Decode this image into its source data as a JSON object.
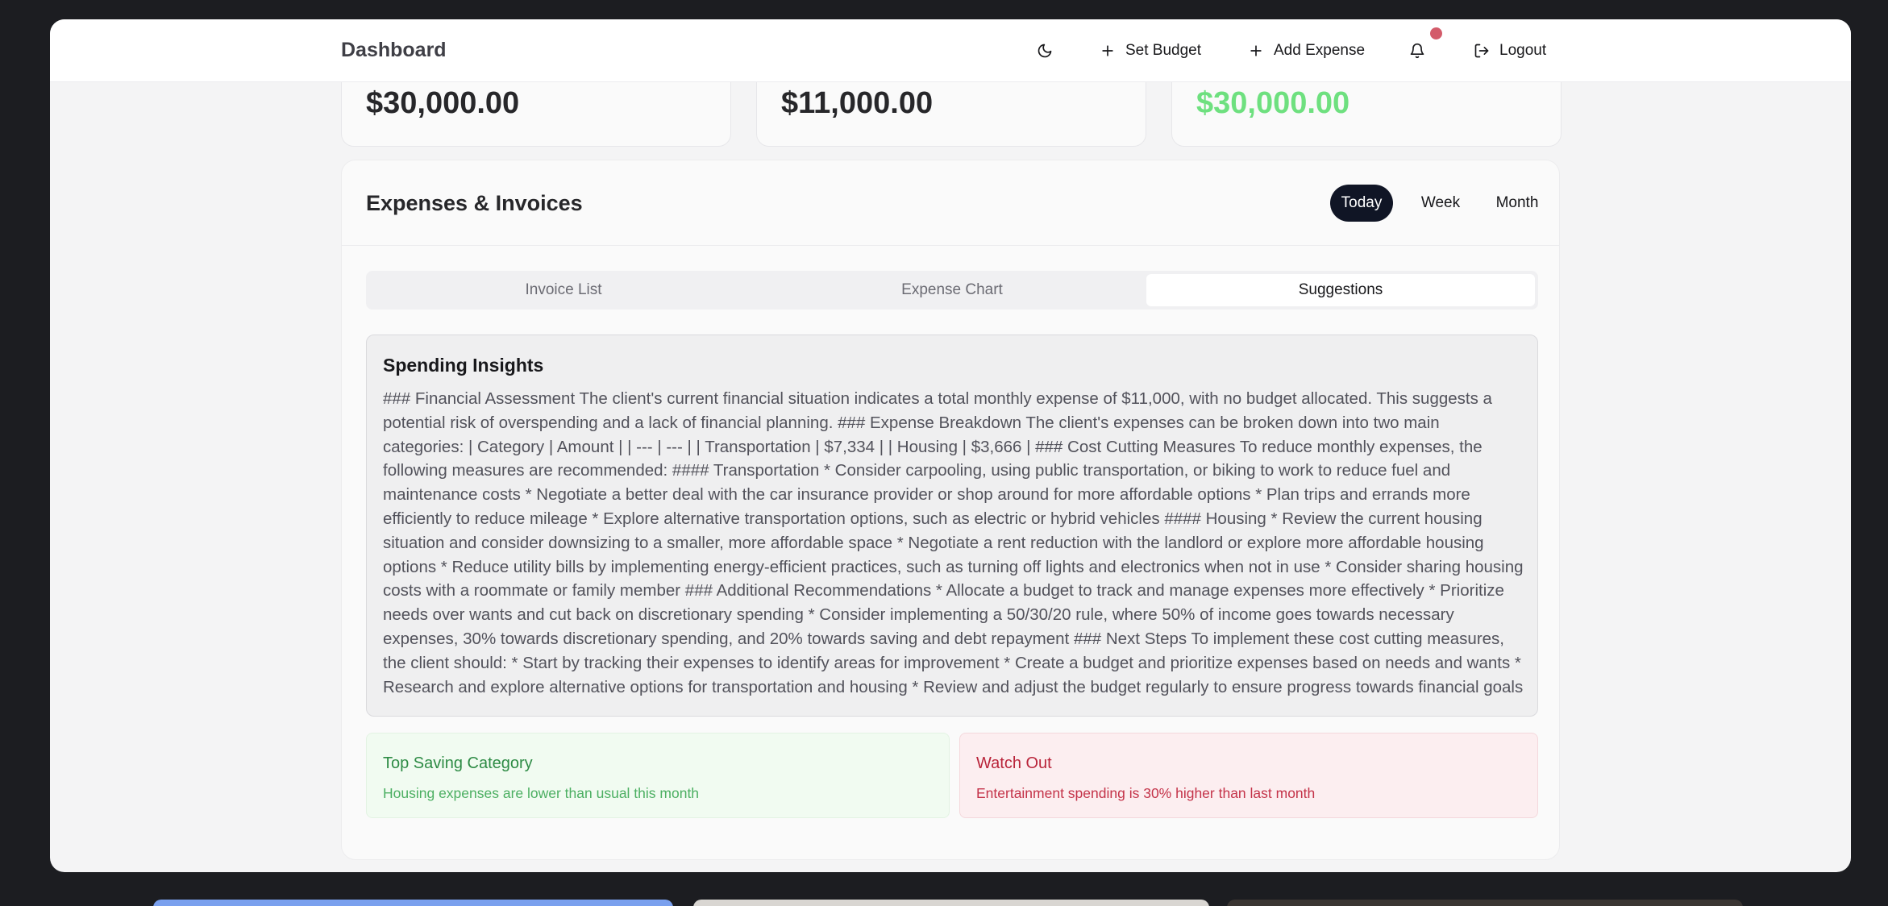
{
  "header": {
    "title": "Dashboard",
    "set_budget_label": "Set Budget",
    "add_expense_label": "Add Expense",
    "logout_label": "Logout",
    "has_notification": true
  },
  "stats": [
    {
      "value": "$30,000.00",
      "color": "#27272a"
    },
    {
      "value": "$11,000.00",
      "color": "#27272a"
    },
    {
      "value": "$30,000.00",
      "color": "#6ee07f"
    }
  ],
  "panel": {
    "title": "Expenses & Invoices",
    "ranges": [
      "Today",
      "Week",
      "Month"
    ],
    "active_range": "Today",
    "tabs": [
      "Invoice List",
      "Expense Chart",
      "Suggestions"
    ],
    "active_tab": "Suggestions"
  },
  "insights": {
    "title": "Spending Insights",
    "body": "### Financial Assessment The client's current financial situation indicates a total monthly expense of $11,000, with no budget allocated. This suggests a potential risk of overspending and a lack of financial planning. ### Expense Breakdown The client's expenses can be broken down into two main categories: | Category | Amount | | --- | --- | | Transportation | $7,334 | | Housing | $3,666 | ### Cost Cutting Measures To reduce monthly expenses, the following measures are recommended: #### Transportation * Consider carpooling, using public transportation, or biking to work to reduce fuel and maintenance costs * Negotiate a better deal with the car insurance provider or shop around for more affordable options * Plan trips and errands more efficiently to reduce mileage * Explore alternative transportation options, such as electric or hybrid vehicles #### Housing * Review the current housing situation and consider downsizing to a smaller, more affordable space * Negotiate a rent reduction with the landlord or explore more affordable housing options * Reduce utility bills by implementing energy-efficient practices, such as turning off lights and electronics when not in use * Consider sharing housing costs with a roommate or family member ### Additional Recommendations * Allocate a budget to track and manage expenses more effectively * Prioritize needs over wants and cut back on discretionary spending * Consider implementing a 50/30/20 rule, where 50% of income goes towards necessary expenses, 30% towards discretionary spending, and 20% towards saving and debt repayment ### Next Steps To implement these cost cutting measures, the client should: * Start by tracking their expenses to identify areas for improvement * Create a budget and prioritize expenses based on needs and wants * Research and explore alternative options for transportation and housing * Review and adjust the budget regularly to ensure progress towards financial goals"
  },
  "tips": {
    "good": {
      "title": "Top Saving Category",
      "text": "Housing expenses are lower than usual this month",
      "color": "#2e8b45"
    },
    "bad": {
      "title": "Watch Out",
      "text": "Entertainment spending is 30% higher than last month",
      "color": "#b9243a"
    }
  },
  "icons": {
    "theme": "moon-icon",
    "set_budget": "plus-icon",
    "add_expense": "plus-icon",
    "notifications": "bell-icon",
    "logout": "logout-icon"
  }
}
